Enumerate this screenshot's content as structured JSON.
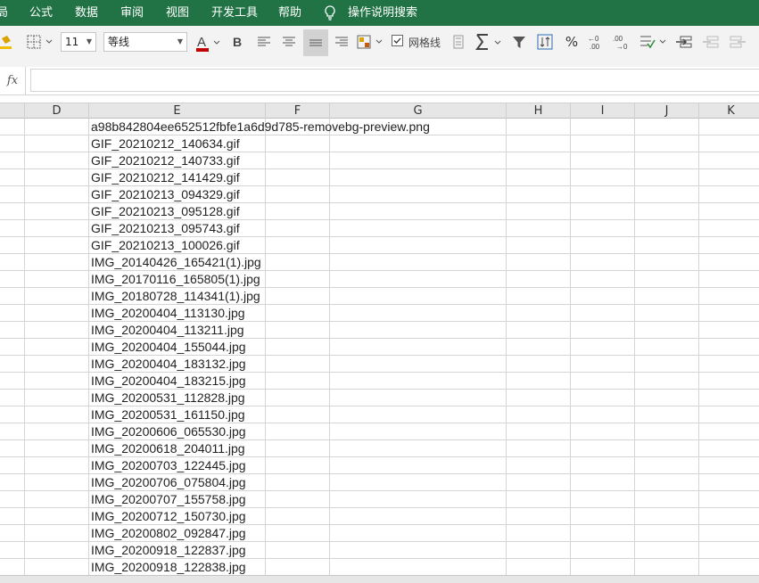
{
  "ribbon": {
    "tabs": [
      "局",
      "公式",
      "数据",
      "审阅",
      "视图",
      "开发工具",
      "帮助"
    ],
    "search_label": "操作说明搜索"
  },
  "toolbar": {
    "font_size": "11",
    "font_name": "等线",
    "bold": "B",
    "gridlines_label": "网格线",
    "gridlines_checked": true,
    "percent": "%",
    "font_color": "#c00000"
  },
  "formula_bar": {
    "fx_label": "fx",
    "content": ""
  },
  "columns": [
    "D",
    "E",
    "F",
    "G",
    "H",
    "I",
    "J",
    "K"
  ],
  "cells_E": [
    "a98b842804ee652512fbfe1a6d9d785-removebg-preview.png",
    "GIF_20210212_140634.gif",
    "GIF_20210212_140733.gif",
    "GIF_20210212_141429.gif",
    "GIF_20210213_094329.gif",
    "GIF_20210213_095128.gif",
    "GIF_20210213_095743.gif",
    "GIF_20210213_100026.gif",
    "IMG_20140426_165421(1).jpg",
    "IMG_20170116_165805(1).jpg",
    "IMG_20180728_114341(1).jpg",
    "IMG_20200404_113130.jpg",
    "IMG_20200404_113211.jpg",
    "IMG_20200404_155044.jpg",
    "IMG_20200404_183132.jpg",
    "IMG_20200404_183215.jpg",
    "IMG_20200531_112828.jpg",
    "IMG_20200531_161150.jpg",
    "IMG_20200606_065530.jpg",
    "IMG_20200618_204011.jpg",
    "IMG_20200703_122445.jpg",
    "IMG_20200706_075804.jpg",
    "IMG_20200707_155758.jpg",
    "IMG_20200712_150730.jpg",
    "IMG_20200802_092847.jpg",
    "IMG_20200918_122837.jpg",
    "IMG_20200918_122838.jpg"
  ]
}
